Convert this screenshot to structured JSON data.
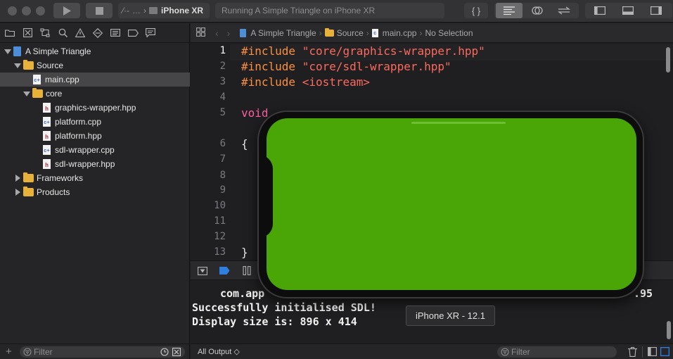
{
  "toolbar": {
    "scheme_target": "…",
    "device": "iPhone XR",
    "activity_status": "Running A Simple Triangle on iPhone XR",
    "code_review_label": "{ }"
  },
  "navigator": {
    "tree": [
      {
        "label": "A Simple Triangle",
        "kind": "project",
        "depth": 0,
        "expanded": true
      },
      {
        "label": "Source",
        "kind": "folder",
        "depth": 1,
        "expanded": true
      },
      {
        "label": "main.cpp",
        "kind": "cpp",
        "depth": 2,
        "selected": true
      },
      {
        "label": "core",
        "kind": "folder",
        "depth": 2,
        "expanded": true
      },
      {
        "label": "graphics-wrapper.hpp",
        "kind": "hpp",
        "depth": 3
      },
      {
        "label": "platform.cpp",
        "kind": "cpp",
        "depth": 3
      },
      {
        "label": "platform.hpp",
        "kind": "hpp",
        "depth": 3
      },
      {
        "label": "sdl-wrapper.cpp",
        "kind": "cpp",
        "depth": 3
      },
      {
        "label": "sdl-wrapper.hpp",
        "kind": "hpp",
        "depth": 3
      },
      {
        "label": "Frameworks",
        "kind": "folder",
        "depth": 1,
        "expanded": false
      },
      {
        "label": "Products",
        "kind": "folder",
        "depth": 1,
        "expanded": false
      }
    ],
    "filter_placeholder": "Filter"
  },
  "jumpbar": {
    "crumbs": [
      "A Simple Triangle",
      "Source",
      "main.cpp",
      "No Selection"
    ]
  },
  "editor": {
    "current_line": 1,
    "lines": [
      {
        "num": "1",
        "parts": [
          [
            "pp",
            "#include "
          ],
          [
            "str",
            "\"core/graphics-wrapper.hpp\""
          ]
        ]
      },
      {
        "num": "2",
        "parts": [
          [
            "pp",
            "#include "
          ],
          [
            "str",
            "\"core/sdl-wrapper.hpp\""
          ]
        ]
      },
      {
        "num": "3",
        "parts": [
          [
            "pp",
            "#include "
          ],
          [
            "str",
            "<iostream>"
          ]
        ]
      },
      {
        "num": "4",
        "parts": []
      },
      {
        "num": "5",
        "parts": [
          [
            "kw",
            "void"
          ]
        ]
      },
      {
        "num": "6",
        "parts": [
          [
            "plain",
            "{"
          ]
        ]
      },
      {
        "num": "7",
        "parts": []
      },
      {
        "num": "8",
        "parts": []
      },
      {
        "num": "9",
        "parts": []
      },
      {
        "num": "10",
        "parts": []
      },
      {
        "num": "11",
        "parts": []
      },
      {
        "num": "12",
        "parts": []
      },
      {
        "num": "13",
        "parts": [
          [
            "plain",
            "}"
          ]
        ]
      }
    ]
  },
  "console": {
    "lines": [
      "com.app",
      "Successfully initialised SDL!",
      "Display size is: 896 x 414"
    ],
    "trailing_fragment": ".95",
    "output_selector": "All Output ◇",
    "filter_placeholder": "Filter"
  },
  "simulator": {
    "screen_color": "#4aa506",
    "tooltip": "iPhone XR - 12.1"
  }
}
